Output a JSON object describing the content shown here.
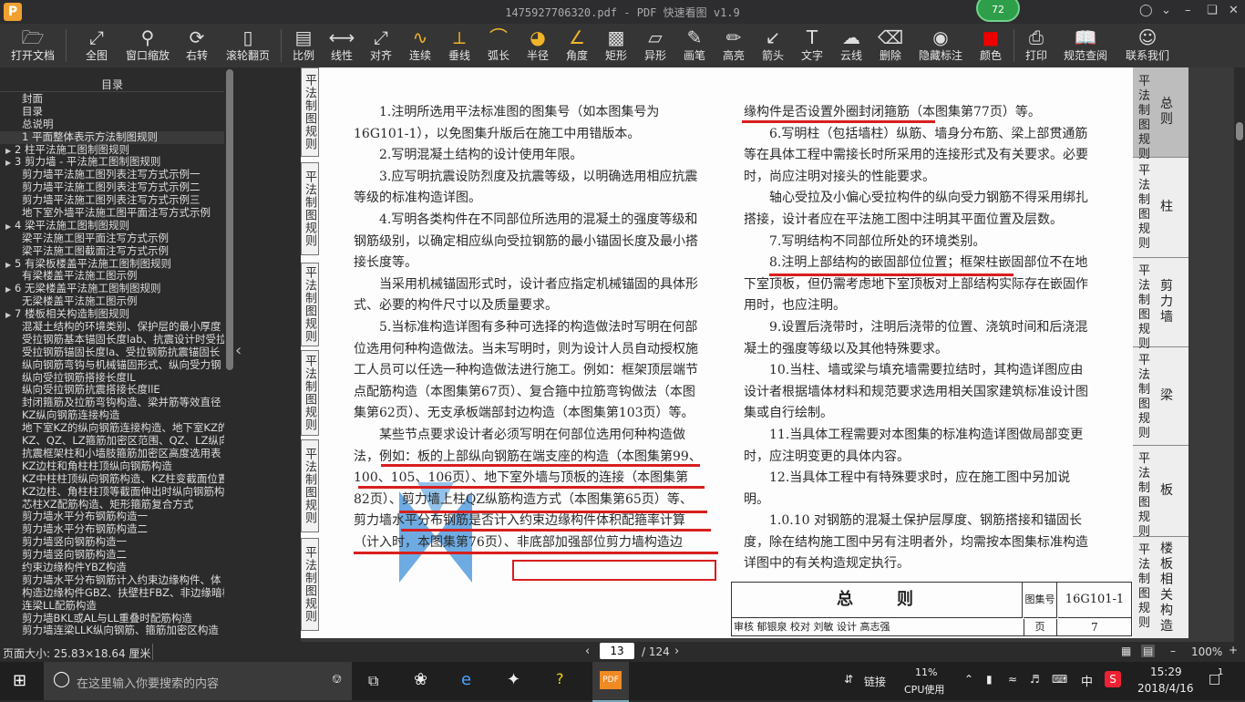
{
  "window": {
    "title": "1475927706320.pdf - PDF 快速看图 v1.9",
    "logo_letter": "P",
    "badge": "72"
  },
  "toolbar": {
    "items": [
      {
        "label": "打开文档",
        "icon": "folder-icon"
      },
      {
        "label": "全图",
        "icon": "fit-all-icon"
      },
      {
        "label": "窗口缩放",
        "icon": "zoom-window-icon"
      },
      {
        "label": "右转",
        "icon": "rotate-right-icon"
      },
      {
        "label": "滚轮翻页",
        "icon": "mouse-wheel-icon"
      },
      {
        "label": "比例",
        "icon": "scale-icon"
      },
      {
        "label": "线性",
        "icon": "linear-measure-icon"
      },
      {
        "label": "对齐",
        "icon": "aligned-measure-icon"
      },
      {
        "label": "连续",
        "icon": "continuous-measure-icon"
      },
      {
        "label": "垂线",
        "icon": "perpendicular-icon"
      },
      {
        "label": "弧长",
        "icon": "arc-length-icon"
      },
      {
        "label": "半径",
        "icon": "radius-icon"
      },
      {
        "label": "角度",
        "icon": "angle-icon"
      },
      {
        "label": "矩形",
        "icon": "rectangle-area-icon"
      },
      {
        "label": "异形",
        "icon": "irregular-area-icon"
      },
      {
        "label": "画笔",
        "icon": "pen-icon"
      },
      {
        "label": "高亮",
        "icon": "highlighter-icon"
      },
      {
        "label": "箭头",
        "icon": "arrow-icon"
      },
      {
        "label": "文字",
        "icon": "text-icon"
      },
      {
        "label": "云线",
        "icon": "cloud-line-icon"
      },
      {
        "label": "删除",
        "icon": "eraser-icon"
      },
      {
        "label": "隐藏标注",
        "icon": "hide-annotation-icon"
      },
      {
        "label": "颜色",
        "icon": "color-swatch-icon"
      },
      {
        "label": "打印",
        "icon": "printer-icon"
      },
      {
        "label": "规范查阅",
        "icon": "book-search-icon"
      },
      {
        "label": "联系我们",
        "icon": "headset-icon"
      }
    ]
  },
  "sidebar": {
    "header": "目录",
    "items": [
      {
        "label": "封面",
        "arrow": false,
        "indent": true
      },
      {
        "label": "目录",
        "arrow": false,
        "indent": true
      },
      {
        "label": "总说明",
        "arrow": false,
        "indent": true
      },
      {
        "label": "1 平面整体表示方法制图规则",
        "arrow": false,
        "indent": true,
        "selected": true
      },
      {
        "label": "2 柱平法施工图制图规则",
        "arrow": true,
        "indent": false
      },
      {
        "label": "3 剪力墙 - 平法施工图制图规则",
        "arrow": true,
        "indent": false
      },
      {
        "label": "剪力墙平法施工图列表注写方式示例一",
        "arrow": false,
        "indent": true
      },
      {
        "label": "剪力墙平法施工图列表注写方式示例二",
        "arrow": false,
        "indent": true
      },
      {
        "label": "剪力墙平法施工图列表注写方式示例三",
        "arrow": false,
        "indent": true
      },
      {
        "label": "地下室外墙平法施工图平面注写方式示例",
        "arrow": false,
        "indent": true
      },
      {
        "label": "4 梁平法施工图制图规则",
        "arrow": true,
        "indent": false
      },
      {
        "label": "梁平法施工图平面注写方式示例",
        "arrow": false,
        "indent": true
      },
      {
        "label": "梁平法施工图截面注写方式示例",
        "arrow": false,
        "indent": true
      },
      {
        "label": "5 有梁板楼盖平法施工图制图规则",
        "arrow": true,
        "indent": false
      },
      {
        "label": "有梁楼盖平法施工图示例",
        "arrow": false,
        "indent": true
      },
      {
        "label": "6 无梁楼盖平法施工图制图规则",
        "arrow": true,
        "indent": false
      },
      {
        "label": "无梁楼盖平法施工图示例",
        "arrow": false,
        "indent": true
      },
      {
        "label": "7 楼板相关构造制图规则",
        "arrow": true,
        "indent": false
      },
      {
        "label": "混凝土结构的环境类别、保护层的最小厚度",
        "arrow": false,
        "indent": true
      },
      {
        "label": "受拉钢筋基本锚固长度lab、抗震设计时受拉",
        "arrow": false,
        "indent": true
      },
      {
        "label": "受拉钢筋锚固长度la、受拉钢筋抗震锚固长",
        "arrow": false,
        "indent": true
      },
      {
        "label": "纵向钢筋弯钩与机械锚固形式、纵向受力钢",
        "arrow": false,
        "indent": true
      },
      {
        "label": "纵向受拉钢筋搭接长度lL",
        "arrow": false,
        "indent": true
      },
      {
        "label": "纵向受拉钢筋抗震搭接长度llE",
        "arrow": false,
        "indent": true
      },
      {
        "label": "封闭箍筋及拉筋弯钩构造、梁并筋等效直径",
        "arrow": false,
        "indent": true
      },
      {
        "label": "KZ纵向钢筋连接构造",
        "arrow": false,
        "indent": true
      },
      {
        "label": "地下室KZ的纵向钢筋连接构造、地下室KZ的",
        "arrow": false,
        "indent": true
      },
      {
        "label": "KZ、QZ、LZ箍筋加密区范围、QZ、LZ纵向钢",
        "arrow": false,
        "indent": true
      },
      {
        "label": "抗震框架柱和小墙肢箍筋加密区高度选用表",
        "arrow": false,
        "indent": true
      },
      {
        "label": "KZ边柱和角柱柱顶纵向钢筋构造",
        "arrow": false,
        "indent": true
      },
      {
        "label": "KZ中柱柱顶纵向钢筋构造、KZ柱变截面位置",
        "arrow": false,
        "indent": true
      },
      {
        "label": "KZ边柱、角柱柱顶等截面伸出时纵向钢筋构",
        "arrow": false,
        "indent": true
      },
      {
        "label": "芯柱XZ配筋构造、矩形箍筋复合方式",
        "arrow": false,
        "indent": true
      },
      {
        "label": "剪力墙水平分布钢筋构造一",
        "arrow": false,
        "indent": true
      },
      {
        "label": "剪力墙水平分布钢筋构造二",
        "arrow": false,
        "indent": true
      },
      {
        "label": "剪力墙竖向钢筋构造一",
        "arrow": false,
        "indent": true
      },
      {
        "label": "剪力墙竖向钢筋构造二",
        "arrow": false,
        "indent": true
      },
      {
        "label": "约束边缘构件YBZ构造",
        "arrow": false,
        "indent": true
      },
      {
        "label": "剪力墙水平分布钢筋计入约束边缘构件、体",
        "arrow": false,
        "indent": true
      },
      {
        "label": "构造边缘构件GBZ、扶壁柱FBZ、非边缘暗柱",
        "arrow": false,
        "indent": true
      },
      {
        "label": "连梁LL配筋构造",
        "arrow": false,
        "indent": true
      },
      {
        "label": "剪力墙BKL或AL与LL重叠时配筋构造",
        "arrow": false,
        "indent": true
      },
      {
        "label": "剪力墙连梁LLK纵向钢筋、箍筋加密区构造",
        "arrow": false,
        "indent": true
      }
    ]
  },
  "page": {
    "left_tabs": [
      "平法制图规则",
      "平法制图规则",
      "平法制图规则",
      "平法制图规则",
      "平法制图规则",
      "平法制图规则"
    ],
    "col1": [
      "1.注明所选用平法标准图的图集号（如本图集号为16G101-1），以免图集升版后在施工中用错版本。",
      "2.写明混凝土结构的设计使用年限。",
      "3.应写明抗震设防烈度及抗震等级，以明确选用相应抗震等级的标准构造详图。",
      "4.写明各类构件在不同部位所选用的混凝土的强度等级和钢筋级别，以确定相应纵向受拉钢筋的最小锚固长度及最小搭接长度等。",
      "当采用机械锚固形式时，设计者应指定机械锚固的具体形式、必要的构件尺寸以及质量要求。",
      "5.当标准构造详图有多种可选择的构造做法时写明在何部位选用何种构造做法。当未写明时，则为设计人员自动授权施工人员可以任选一种构造做法进行施工。例如：框架顶层端节点配筋构造（本图集第67页）、复合箍中拉筋弯钩做法（本图集第62页）、无支承板端部封边构造（本图集第103页）等。",
      "某些节点要求设计者必须写明在何部位选用何种构造做法，例如：板的上部纵向钢筋在端支座的构造（本图集第99、100、105、106页）、地下室外墙与顶板的连接（本图集第82页）、剪力墙上柱QZ纵筋构造方式（本图集第65页）等、剪力墙水平分布钢筋是否计入约束边缘构件体积配箍率计算（计入时，本图集第76页）、非底部加强部位剪力墙构造边"
    ],
    "col2": [
      "缘构件是否设置外圈封闭箍筋（本图集第77页）等。",
      "6.写明柱（包括墙柱）纵筋、墙身分布筋、梁上部贯通筋等在具体工程中需接长时所采用的连接形式及有关要求。必要时，尚应注明对接头的性能要求。",
      "轴心受拉及小偏心受拉构件的纵向受力钢筋不得采用绑扎搭接，设计者应在平法施工图中注明其平面位置及层数。",
      "7.写明结构不同部位所处的环境类别。",
      "8.注明上部结构的嵌固部位位置；框架柱嵌固部位不在地下室顶板，但仍需考虑地下室顶板对上部结构实际存在嵌固作用时，也应注明。",
      "9.设置后浇带时，注明后浇带的位置、浇筑时间和后浇混凝土的强度等级以及其他特殊要求。",
      "10.当柱、墙或梁与填充墙需要拉结时，其构造详图应由设计者根据墙体材料和规范要求选用相关国家建筑标准设计图集或自行绘制。",
      "11.当具体工程需要对本图集的标准构造详图做局部变更时，应注明变更的具体内容。",
      "12.当具体工程中有特殊要求时，应在施工图中另加说明。",
      "1.0.10 对钢筋的混凝土保护层厚度、钢筋搭接和锚固长度，除在结构施工图中另有注明者外，均需按本图集标准构造详图中的有关构造规定执行。"
    ],
    "titleblock": {
      "title": "总　　则",
      "atlas_label": "图集号",
      "atlas_no": "16G101-1",
      "row": "审核 郁银泉 校对 刘敏 设计 高志强",
      "page_label": "页",
      "page_no": "7"
    },
    "right_tabs": [
      {
        "a": "平法制图规则",
        "b": "总则"
      },
      {
        "a": "平法制图规则",
        "b": "柱"
      },
      {
        "a": "平法制图规则",
        "b": "剪力墙"
      },
      {
        "a": "平法制图规则",
        "b": "梁"
      },
      {
        "a": "平法制图规则",
        "b": "板"
      },
      {
        "a": "平法制图规则",
        "b": "楼板相关构造"
      }
    ]
  },
  "status": {
    "page_size": "页面大小: 25.83×18.64 厘米",
    "current_page": "13",
    "total_pages": "/ 124",
    "zoom": "100%"
  },
  "taskbar": {
    "search_placeholder": "在这里输入你要搜索的内容",
    "link_label": "链接",
    "cpu_value": "11%",
    "cpu_label": "CPU使用",
    "ime": "中",
    "time": "15:29",
    "date": "2018/4/16",
    "notification_count": "1"
  },
  "colors": {
    "annotation_red": "#d81e1e",
    "watermark_blue": "#3d8fd8",
    "badge_green": "#2e9e4a"
  }
}
